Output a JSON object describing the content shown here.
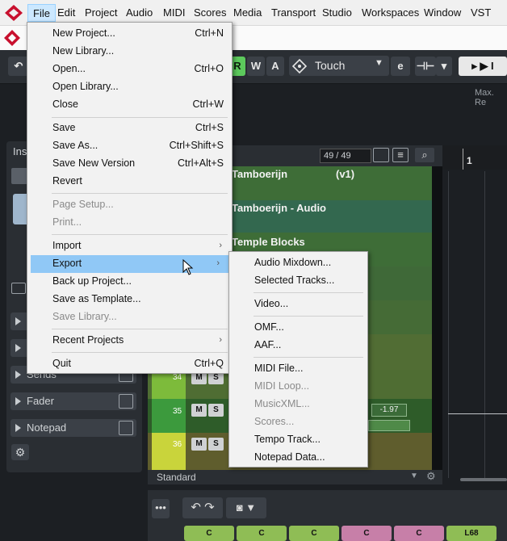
{
  "menubar": {
    "items": [
      "File",
      "Edit",
      "Project",
      "Audio",
      "MIDI",
      "Scores",
      "Media",
      "Transport",
      "Studio",
      "Workspaces",
      "Window",
      "VST Clou"
    ]
  },
  "toolbar": {
    "r_label": "R",
    "w_label": "W",
    "a_label": "A",
    "automation_mode": "Touch",
    "max_rec_label": "Max. Re"
  },
  "inspector": {
    "title": "Ins",
    "sections": [
      "Sends",
      "Fader",
      "Notepad"
    ]
  },
  "tracks": {
    "counter": "49 / 49",
    "items": [
      {
        "name": "Tamboerijn",
        "version": "(v1)"
      },
      {
        "name": "Tamboerijn - Audio"
      },
      {
        "name": "Temple Blocks"
      }
    ],
    "numbers": [
      "34",
      "35",
      "36"
    ],
    "volume": "-1.97",
    "m_label": "M",
    "s_label": "S",
    "footer": "Standard"
  },
  "ruler": {
    "bar": "1"
  },
  "clips": [
    "C",
    "C",
    "C",
    "C",
    "C",
    "L68"
  ],
  "file_menu": {
    "items": [
      {
        "label": "New Project...",
        "shortcut": "Ctrl+N",
        "disabled": false
      },
      {
        "label": "New Library...",
        "shortcut": "",
        "disabled": false
      },
      {
        "label": "Open...",
        "shortcut": "Ctrl+O",
        "disabled": false
      },
      {
        "label": "Open Library...",
        "shortcut": "",
        "disabled": false
      },
      {
        "label": "Close",
        "shortcut": "Ctrl+W",
        "disabled": false
      },
      {
        "label": "Save",
        "shortcut": "Ctrl+S",
        "disabled": false
      },
      {
        "label": "Save As...",
        "shortcut": "Ctrl+Shift+S",
        "disabled": false
      },
      {
        "label": "Save New Version",
        "shortcut": "Ctrl+Alt+S",
        "disabled": false
      },
      {
        "label": "Revert",
        "shortcut": "",
        "disabled": false
      },
      {
        "label": "Page Setup...",
        "shortcut": "",
        "disabled": true
      },
      {
        "label": "Print...",
        "shortcut": "",
        "disabled": true
      },
      {
        "label": "Import",
        "shortcut": "",
        "disabled": false
      },
      {
        "label": "Export",
        "shortcut": "",
        "disabled": false
      },
      {
        "label": "Back up Project...",
        "shortcut": "",
        "disabled": false
      },
      {
        "label": "Save as Template...",
        "shortcut": "",
        "disabled": false
      },
      {
        "label": "Save Library...",
        "shortcut": "",
        "disabled": true
      },
      {
        "label": "Recent Projects",
        "shortcut": "",
        "disabled": false
      },
      {
        "label": "Quit",
        "shortcut": "Ctrl+Q",
        "disabled": false
      }
    ]
  },
  "export_menu": {
    "items": [
      {
        "label": "Audio Mixdown...",
        "disabled": false
      },
      {
        "label": "Selected Tracks...",
        "disabled": false
      },
      {
        "label": "Video...",
        "disabled": false
      },
      {
        "label": "OMF...",
        "disabled": false
      },
      {
        "label": "AAF...",
        "disabled": false
      },
      {
        "label": "MIDI File...",
        "disabled": false
      },
      {
        "label": "MIDI Loop...",
        "disabled": true
      },
      {
        "label": "MusicXML...",
        "disabled": true
      },
      {
        "label": "Scores...",
        "disabled": true
      },
      {
        "label": "Tempo Track...",
        "disabled": false
      },
      {
        "label": "Notepad Data...",
        "disabled": false
      }
    ]
  },
  "colors": {
    "highlight": "#90c8f6",
    "menubar_active": "#cce8ff",
    "track_green": "#3c6a35",
    "clip_green": "#8fbd55",
    "clip_pink": "#c77fa8"
  }
}
